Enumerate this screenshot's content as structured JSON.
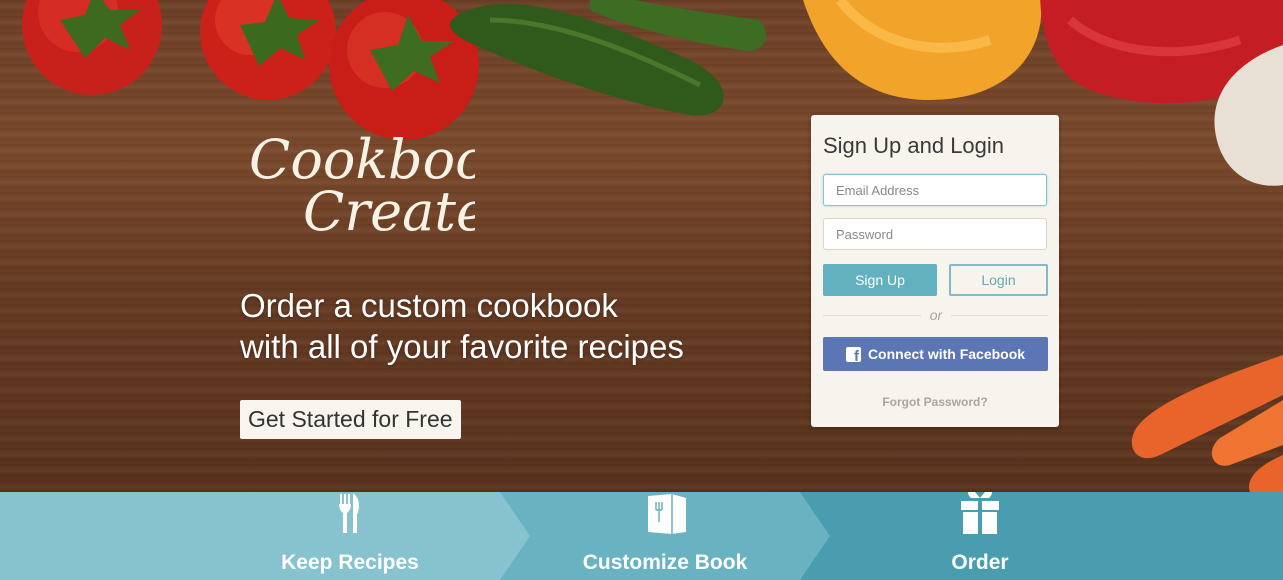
{
  "brand": {
    "logo_line1": "Cookbook",
    "logo_line2": "Create"
  },
  "hero": {
    "tagline_line1": "Order a custom cookbook",
    "tagline_line2": "with all of your favorite recipes",
    "cta_label": "Get Started for Free"
  },
  "auth": {
    "title": "Sign Up and Login",
    "email_placeholder": "Email Address",
    "email_value": "",
    "password_placeholder": "Password",
    "password_value": "",
    "signup_label": "Sign Up",
    "login_label": "Login",
    "or_label": "or",
    "facebook_label": "Connect with Facebook",
    "forgot_label": "Forgot Password?"
  },
  "steps": [
    {
      "label": "Keep Recipes",
      "icon": "fork-knife-icon"
    },
    {
      "label": "Customize Book",
      "icon": "book-icon"
    },
    {
      "label": "Order",
      "icon": "gift-icon"
    }
  ],
  "colors": {
    "accent": "#63b1bf",
    "facebook": "#5c75b4",
    "step1": "#86c3cf",
    "step2": "#68b2c1",
    "step3": "#4a9daf"
  }
}
